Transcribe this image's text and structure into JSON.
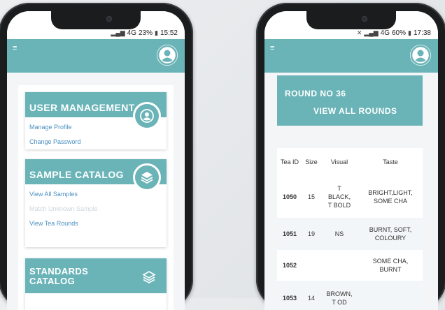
{
  "left_phone": {
    "status": {
      "signal": "4G",
      "battery": "23%",
      "time": "15:52"
    },
    "cards": [
      {
        "title": "USER MANAGEMENT",
        "icon": "user-icon",
        "links": [
          {
            "label": "Manage Profile",
            "enabled": true
          },
          {
            "label": "Change Password",
            "enabled": true
          }
        ]
      },
      {
        "title": "SAMPLE CATALOG",
        "icon": "layers-icon",
        "links": [
          {
            "label": "View All Samples",
            "enabled": true
          },
          {
            "label": "Match Unknown Sample",
            "enabled": false
          },
          {
            "label": "View Tea Rounds",
            "enabled": true
          }
        ]
      },
      {
        "title_line1": "STANDARDS",
        "title_line2": "CATALOG",
        "icon": "layers-icon"
      }
    ]
  },
  "right_phone": {
    "status": {
      "signal": "4G",
      "battery": "60%",
      "time": "17:38"
    },
    "round_title": "ROUND NO 36",
    "view_all_rounds": "VIEW ALL ROUNDS",
    "table": {
      "headers": [
        "Tea ID",
        "Size",
        "Visual",
        "Taste"
      ],
      "rows": [
        {
          "id": "1050",
          "size": "15",
          "visual": [
            "T",
            "BLACK,",
            "T BOLD"
          ],
          "taste": [
            "BRIGHT,LIGHT,",
            "SOME CHA"
          ]
        },
        {
          "id": "1051",
          "size": "19",
          "visual": [
            "NS"
          ],
          "taste": [
            "BURNT, SOFT,",
            "COLOURY"
          ]
        },
        {
          "id": "1052",
          "size": "",
          "visual": [],
          "taste": [
            "SOME CHA,",
            "BURNT"
          ]
        },
        {
          "id": "1053",
          "size": "14",
          "visual": [
            "BROWN,",
            "T OD"
          ],
          "taste": []
        }
      ]
    }
  },
  "colors": {
    "accent": "#6ab4b8",
    "link": "#4a90c2",
    "background": "#f3f5f7"
  }
}
